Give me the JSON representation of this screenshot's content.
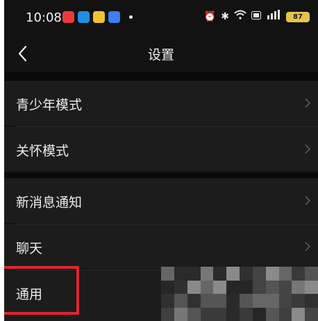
{
  "status_bar": {
    "time": "10:08",
    "app_icons": [
      {
        "name": "app-red-icon",
        "color": "#e73b3b"
      },
      {
        "name": "app-blue-icon",
        "color": "#1f8fe0"
      },
      {
        "name": "app-yellow-icon",
        "color": "#f2c230"
      },
      {
        "name": "app-mail-icon",
        "color": "#3d7ef0"
      }
    ],
    "battery": "87"
  },
  "nav": {
    "title": "设置"
  },
  "settings": {
    "items": [
      {
        "label": "青少年模式"
      },
      {
        "label": "关怀模式"
      },
      {
        "label": "新消息通知"
      },
      {
        "label": "聊天"
      },
      {
        "label": "通用"
      }
    ]
  },
  "colors": {
    "background": "#121212",
    "row_background": "#1c1c1c",
    "highlight_border": "#e0262f",
    "battery": "#e6c34a"
  }
}
